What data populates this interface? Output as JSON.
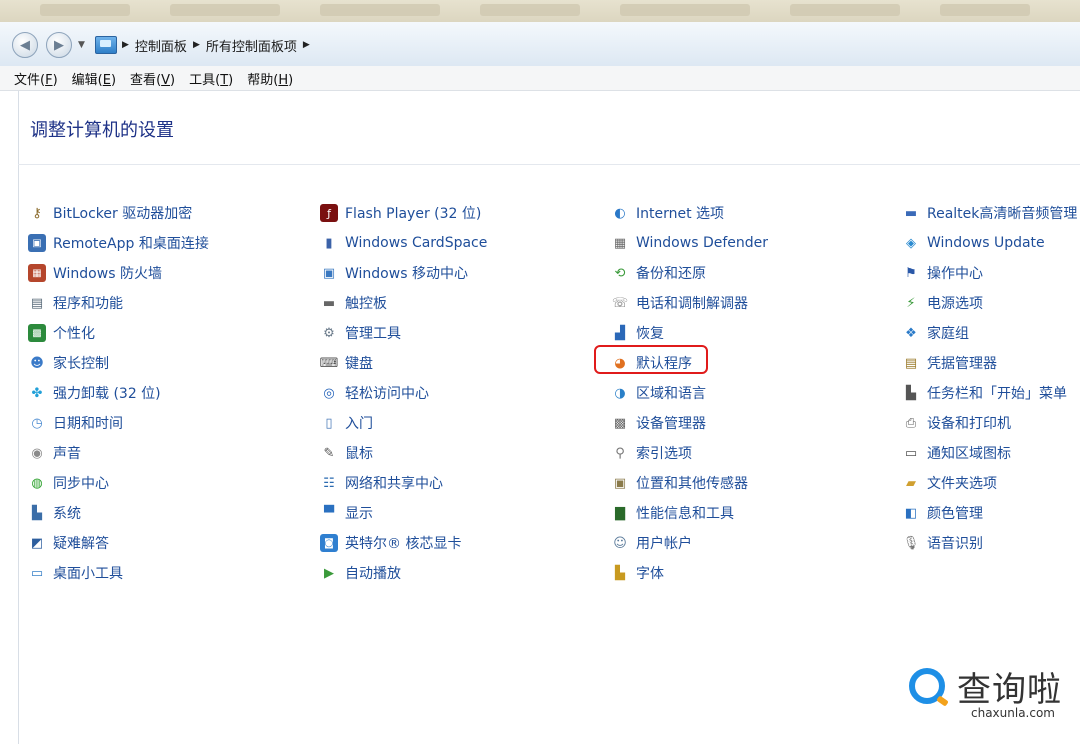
{
  "address_bar": {
    "crumbs": [
      "控制面板",
      "所有控制面板项"
    ]
  },
  "menu": [
    {
      "label": "文件",
      "key": "F"
    },
    {
      "label": "编辑",
      "key": "E"
    },
    {
      "label": "查看",
      "key": "V"
    },
    {
      "label": "工具",
      "key": "T"
    },
    {
      "label": "帮助",
      "key": "H"
    }
  ],
  "page": {
    "title": "调整计算机的设置"
  },
  "columns": [
    [
      {
        "label": "BitLocker 驱动器加密",
        "icon": "key-icon"
      },
      {
        "label": "RemoteApp 和桌面连接",
        "icon": "remoteapp-icon"
      },
      {
        "label": "Windows 防火墙",
        "icon": "firewall-icon"
      },
      {
        "label": "程序和功能",
        "icon": "programs-icon"
      },
      {
        "label": "个性化",
        "icon": "personalize-icon"
      },
      {
        "label": "家长控制",
        "icon": "parental-icon"
      },
      {
        "label": "强力卸载 (32 位)",
        "icon": "uninstall-icon"
      },
      {
        "label": "日期和时间",
        "icon": "datetime-icon"
      },
      {
        "label": "声音",
        "icon": "sound-icon"
      },
      {
        "label": "同步中心",
        "icon": "sync-icon"
      },
      {
        "label": "系统",
        "icon": "system-icon"
      },
      {
        "label": "疑难解答",
        "icon": "troubleshoot-icon"
      },
      {
        "label": "桌面小工具",
        "icon": "gadgets-icon"
      }
    ],
    [
      {
        "label": "Flash Player (32 位)",
        "icon": "flash-icon"
      },
      {
        "label": "Windows CardSpace",
        "icon": "cardspace-icon"
      },
      {
        "label": "Windows 移动中心",
        "icon": "mobility-icon"
      },
      {
        "label": "触控板",
        "icon": "touchpad-icon"
      },
      {
        "label": "管理工具",
        "icon": "admin-tools-icon"
      },
      {
        "label": "键盘",
        "icon": "keyboard-icon"
      },
      {
        "label": "轻松访问中心",
        "icon": "ease-access-icon"
      },
      {
        "label": "入门",
        "icon": "getting-started-icon"
      },
      {
        "label": "鼠标",
        "icon": "mouse-icon"
      },
      {
        "label": "网络和共享中心",
        "icon": "network-icon"
      },
      {
        "label": "显示",
        "icon": "display-icon"
      },
      {
        "label": "英特尔® 核芯显卡",
        "icon": "intel-graphics-icon"
      },
      {
        "label": "自动播放",
        "icon": "autoplay-icon"
      }
    ],
    [
      {
        "label": "Internet 选项",
        "icon": "internet-icon"
      },
      {
        "label": "Windows Defender",
        "icon": "defender-icon"
      },
      {
        "label": "备份和还原",
        "icon": "backup-icon"
      },
      {
        "label": "电话和调制解调器",
        "icon": "phone-icon"
      },
      {
        "label": "恢复",
        "icon": "recovery-icon"
      },
      {
        "label": "默认程序",
        "icon": "default-programs-icon"
      },
      {
        "label": "区域和语言",
        "icon": "region-icon"
      },
      {
        "label": "设备管理器",
        "icon": "device-manager-icon"
      },
      {
        "label": "索引选项",
        "icon": "indexing-icon"
      },
      {
        "label": "位置和其他传感器",
        "icon": "location-icon"
      },
      {
        "label": "性能信息和工具",
        "icon": "performance-icon"
      },
      {
        "label": "用户帐户",
        "icon": "users-icon"
      },
      {
        "label": "字体",
        "icon": "fonts-icon"
      }
    ],
    [
      {
        "label": "Realtek高清晰音频管理",
        "icon": "realtek-icon"
      },
      {
        "label": "Windows Update",
        "icon": "update-icon"
      },
      {
        "label": "操作中心",
        "icon": "action-center-icon"
      },
      {
        "label": "电源选项",
        "icon": "power-icon"
      },
      {
        "label": "家庭组",
        "icon": "homegroup-icon"
      },
      {
        "label": "凭据管理器",
        "icon": "credential-icon"
      },
      {
        "label": "任务栏和「开始」菜单",
        "icon": "taskbar-icon"
      },
      {
        "label": "设备和打印机",
        "icon": "printers-icon"
      },
      {
        "label": "通知区域图标",
        "icon": "notification-icon"
      },
      {
        "label": "文件夹选项",
        "icon": "folder-options-icon"
      },
      {
        "label": "颜色管理",
        "icon": "color-icon"
      },
      {
        "label": "语音识别",
        "icon": "speech-icon"
      }
    ]
  ],
  "watermark": {
    "text": "查询啦",
    "domain": "chaxunla.com"
  }
}
